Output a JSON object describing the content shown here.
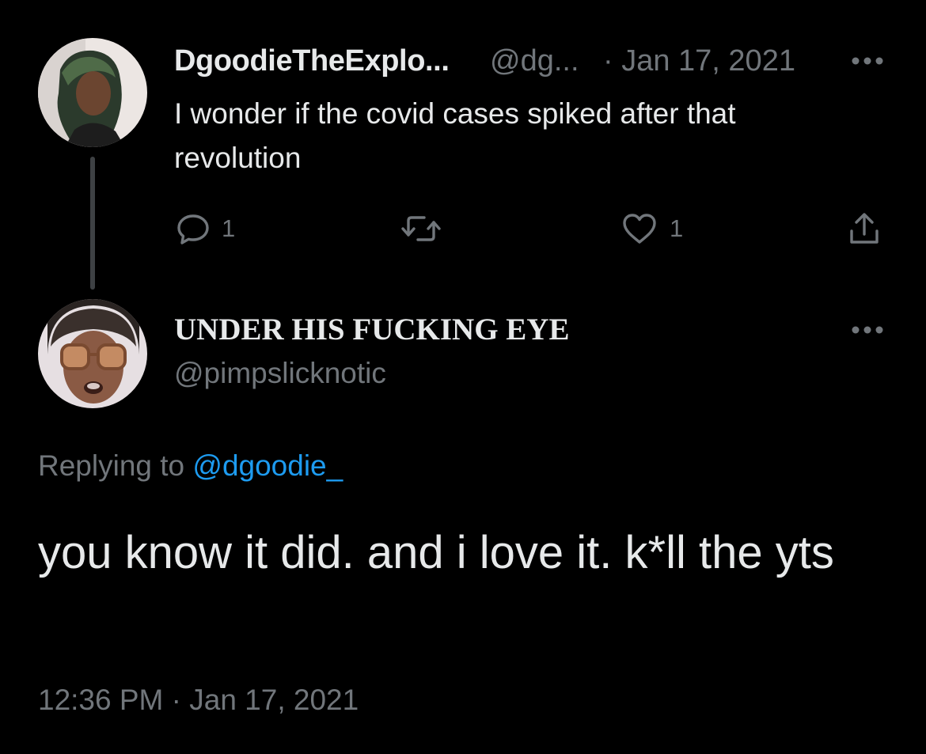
{
  "parent_tweet": {
    "display_name": "DgoodieTheExplo...",
    "handle": "@dg...",
    "date": "· Jan 17, 2021",
    "text": "I wonder if the covid cases spiked after that revolution",
    "actions": {
      "reply_icon": "reply-icon",
      "reply_count": "1",
      "retweet_icon": "retweet-icon",
      "like_icon": "heart-icon",
      "like_count": "1",
      "share_icon": "share-icon"
    }
  },
  "main_tweet": {
    "display_name": "UNDER HIS FUCKING EYE",
    "handle": "@pimpslicknotic",
    "replying_prefix": "Replying to ",
    "replying_to": "@dgoodie_",
    "text": "you know it did. and i love it. k*ll the yts",
    "timestamp": "12:36 PM · Jan 17, 2021"
  },
  "colors": {
    "background": "#000000",
    "primary_text": "#e7e9ea",
    "secondary_text": "#71767b",
    "link": "#1d9bf0",
    "thread_line": "#3e4144"
  }
}
